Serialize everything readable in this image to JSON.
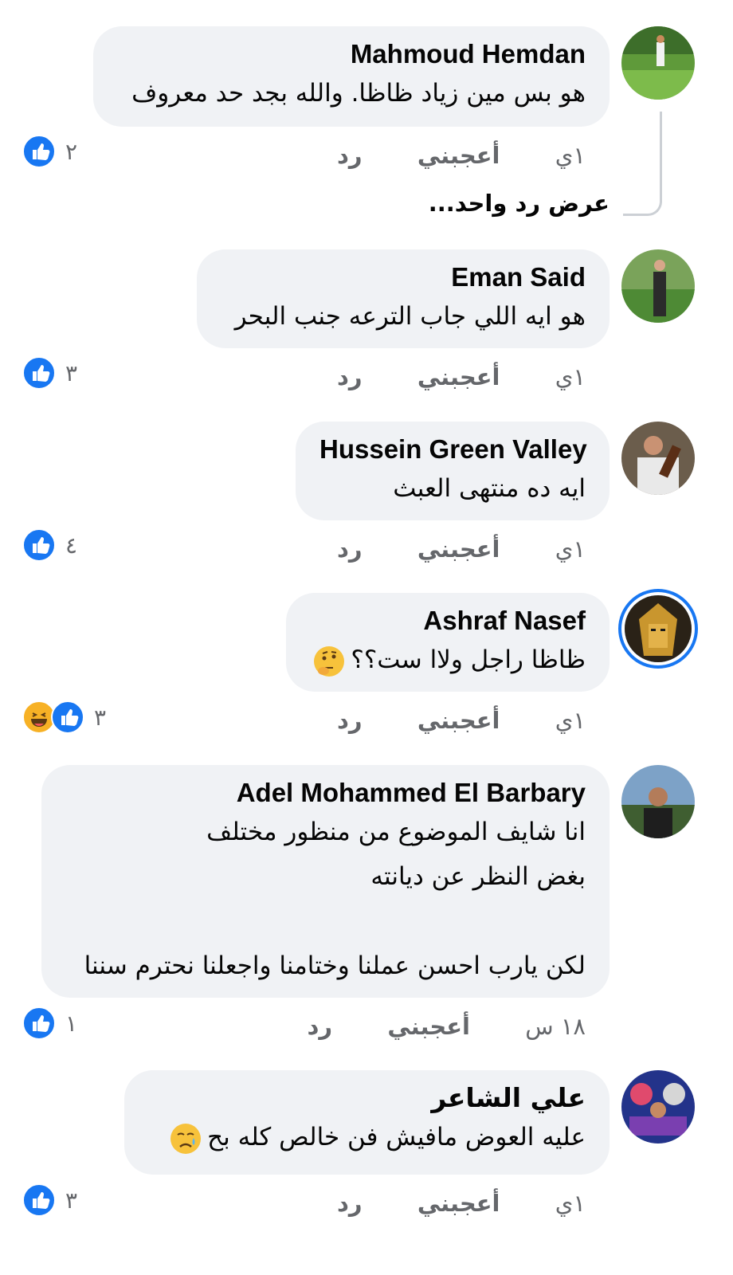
{
  "comments": [
    {
      "name": "Mahmoud Hemdan",
      "lines": [
        "هو بس مين زياد ظاظا. والله بجد حد معروف"
      ],
      "time": "١ي",
      "like": "أعجبني",
      "reply": "رد",
      "reaction_count": "٢",
      "view_replies": "عرض رد واحد..."
    },
    {
      "name": "Eman Said",
      "lines": [
        "هو ايه اللي جاب الترعه جنب البحر"
      ],
      "time": "١ي",
      "like": "أعجبني",
      "reply": "رد",
      "reaction_count": "٣"
    },
    {
      "name": "Hussein Green Valley",
      "lines": [
        "ايه ده منتهى العبث"
      ],
      "time": "١ي",
      "like": "أعجبني",
      "reply": "رد",
      "reaction_count": "٤"
    },
    {
      "name": "Ashraf Nasef",
      "lines": [
        "ظاظا راجل ولاا ست؟؟"
      ],
      "emoji": "thinking-face-emoji",
      "time": "١ي",
      "like": "أعجبني",
      "reply": "رد",
      "reaction_count": "٣"
    },
    {
      "name": "Adel Mohammed El Barbary",
      "lines": [
        "انا شايف الموضوع من منظور مختلف",
        "بغض النظر عن ديانته",
        "",
        "لكن يارب احسن عملنا وختامنا واجعلنا نحترم سننا"
      ],
      "time": "١٨ س",
      "like": "أعجبني",
      "reply": "رد",
      "reaction_count": "١"
    },
    {
      "name": "علي الشاعر",
      "lines": [
        "عليه العوض مافيش فن خالص كله بح"
      ],
      "emoji": "crying-face-emoji",
      "time": "١ي",
      "like": "أعجبني",
      "reply": "رد",
      "reaction_count": "٣"
    }
  ],
  "colors": {
    "bubble": "#f0f2f5",
    "meta": "#65676b",
    "accent": "#1877f2"
  }
}
